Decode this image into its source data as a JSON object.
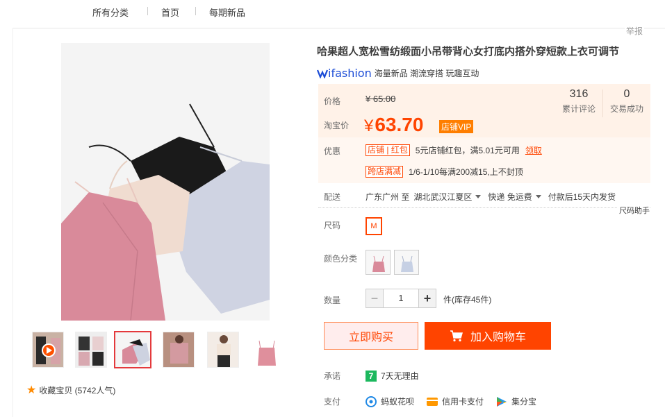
{
  "nav": {
    "all_categories": "所有分类",
    "home": "首页",
    "new_items": "每期新品"
  },
  "report": "举报",
  "product": {
    "title": "哈果超人宽松雪纺缎面小吊带背心女打底内搭外穿短款上衣可调节",
    "brand_name": "ifashion",
    "brand_tagline": "海量新品 潮流穿搭 玩趣互动"
  },
  "price": {
    "label": "价格",
    "original": "¥ 65.00",
    "taobao_label": "淘宝价",
    "currency": "¥",
    "amount": "63.70",
    "vip_badge": "店铺VIP",
    "reviews_count": "316",
    "reviews_label": "累计评论",
    "deals_count": "0",
    "deals_label": "交易成功"
  },
  "promo": {
    "label": "优惠",
    "tag1": "店铺 | 红包",
    "text1": "5元店铺红包，满5.01元可用",
    "claim": "领取",
    "tag2": "跨店满减",
    "text2": "1/6-1/10每满200减15,上不封顶"
  },
  "shipping": {
    "label": "配送",
    "from": "广东广州 至",
    "to": "湖北武汉江夏区",
    "method": "快递 免运费",
    "dispatch": "付款后15天内发货"
  },
  "size_helper": "尺码助手",
  "size": {
    "label": "尺码",
    "options": [
      "M"
    ],
    "selected": "M"
  },
  "color": {
    "label": "颜色分类",
    "options": [
      "pink",
      "blue"
    ]
  },
  "quantity": {
    "label": "数量",
    "value": "1",
    "stock_text": "件(库存45件)",
    "minus": "−",
    "plus": "+"
  },
  "buttons": {
    "buy_now": "立即购买",
    "add_to_cart": "加入购物车"
  },
  "promise": {
    "label": "承诺",
    "icon_text": "7",
    "text": "7天无理由"
  },
  "payment": {
    "label": "支付",
    "methods": [
      "蚂蚁花呗",
      "信用卡支付",
      "集分宝"
    ]
  },
  "favorite": {
    "text": "收藏宝贝 (5742人气)"
  },
  "colors": {
    "accent": "#ff4400",
    "price_bg": "#fff2e8",
    "brand_blue": "#1a4bd6"
  }
}
